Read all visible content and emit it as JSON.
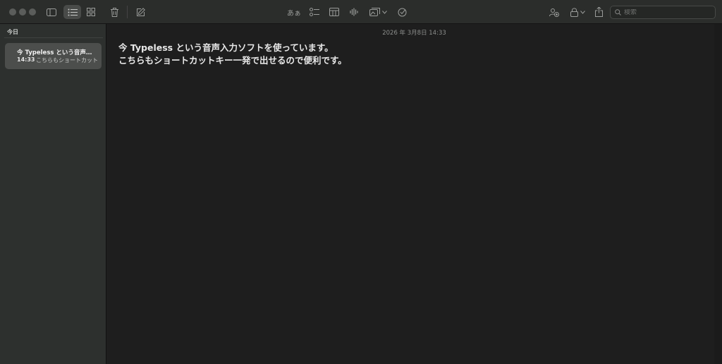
{
  "toolbar": {
    "search_placeholder": "検索",
    "format_label": "あぁ"
  },
  "sidebar": {
    "section_title": "今日",
    "notes": [
      {
        "title": "今 Typeless という音声…",
        "time": "14:33",
        "preview": "こちらもショートカット"
      }
    ]
  },
  "editor": {
    "date": "2026 年 3月8日 14:33",
    "lines": [
      "今 Typeless という音声入力ソフトを使っています。",
      "こちらもショートカットキー一発で出せるので便利です。"
    ]
  },
  "colors": {
    "window_bg": "#1e1e1e",
    "toolbar_bg": "#2b2d2b",
    "sidebar_bg": "#2d302e",
    "selected_note_bg": "#4c4e4c",
    "text": "#e8e8e8"
  }
}
